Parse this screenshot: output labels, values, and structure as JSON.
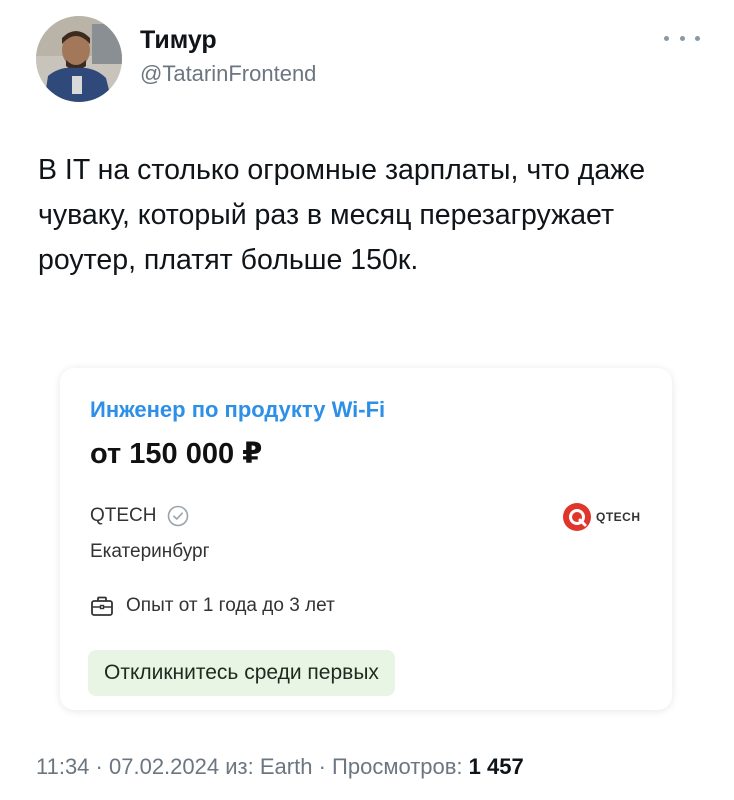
{
  "tweet": {
    "author": {
      "name": "Тимур",
      "handle": "@TatarinFrontend"
    },
    "text": "В IT на столько огромные зарплаты, что даже чуваку, который раз в месяц перезагружает роутер, платят больше 150к.",
    "time": "11:34",
    "separator1": "·",
    "date": "07.02.2024",
    "source_label": "из:",
    "source": "Earth",
    "separator2": "·",
    "views_label": "Просмотров:",
    "views": "1 457"
  },
  "job_card": {
    "title": "Инженер по продукту Wi-Fi",
    "salary": "от 150 000 ₽",
    "company": "QTECH",
    "city": "Екатеринбург",
    "logo_text": "QTECH",
    "experience": "Опыт от 1 года до 3 лет",
    "badge": "Откликнитесь среди первых"
  },
  "icons": {
    "more": "more-dots-icon",
    "verified": "check-circle-icon",
    "experience": "briefcase-icon",
    "logo": "qtech-logo"
  },
  "colors": {
    "title_blue": "#2d8fe6",
    "badge_green": "#e8f5e4",
    "logo_red": "#e0352b",
    "meta_gray": "#6b7680"
  }
}
